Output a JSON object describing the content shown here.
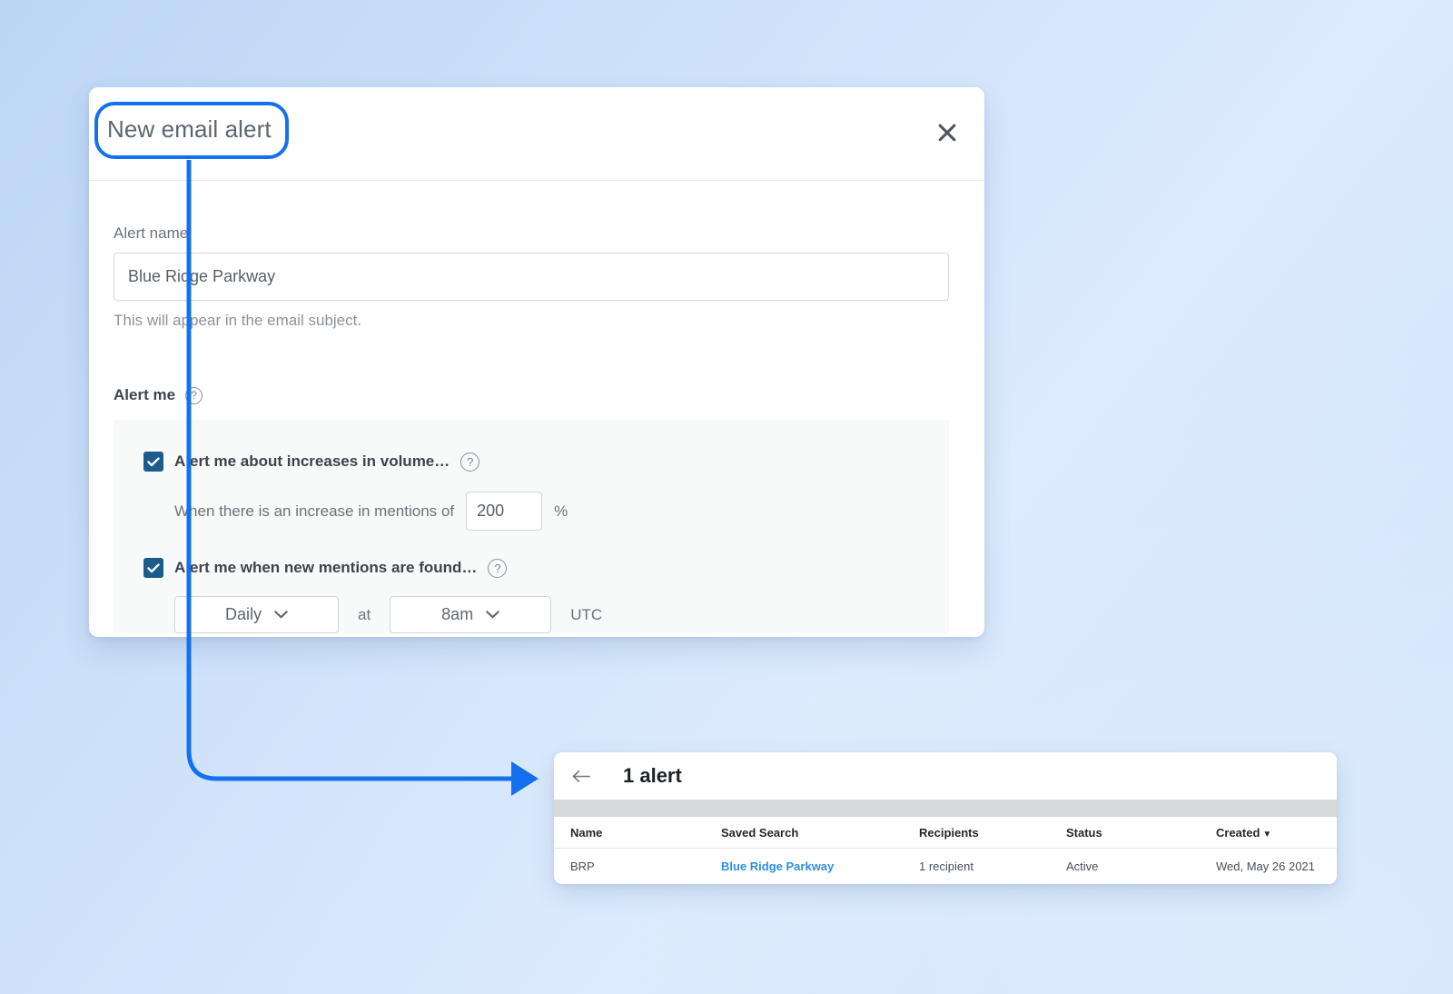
{
  "background": {
    "gradient_from": "#bcd6f5",
    "gradient_to": "#dcebfd"
  },
  "annotation": {
    "color": "#1570ef",
    "callout_target": "New email alert",
    "arrow_from": "dialog-title",
    "arrow_to": "alerts-list-panel"
  },
  "dialog": {
    "title": "New email alert",
    "close_label": "✕",
    "alert_name": {
      "label": "Alert name",
      "value": "Blue Ridge Parkway",
      "placeholder": "Alert name",
      "hint": "This will appear in the email subject."
    },
    "alert_me": {
      "heading": "Alert me",
      "help_glyph": "?",
      "options": [
        {
          "label": "Alert me about increases in volume…",
          "checked": true,
          "help_glyph": "?",
          "sub_prefix": "When there is an increase in mentions of",
          "sub_value": "200",
          "sub_suffix": "%"
        },
        {
          "label": "Alert me when new mentions are found…",
          "checked": true,
          "help_glyph": "?",
          "frequency": "Daily",
          "at_label": "at",
          "time": "8am",
          "timezone": "UTC"
        }
      ]
    }
  },
  "alerts_panel": {
    "back_label": "←",
    "title": "1 alert",
    "columns": [
      {
        "label": "Name",
        "sorted": false
      },
      {
        "label": "Saved Search",
        "sorted": false
      },
      {
        "label": "Recipients",
        "sorted": false
      },
      {
        "label": "Status",
        "sorted": false
      },
      {
        "label": "Created",
        "sorted": true,
        "sort_caret": "▼"
      }
    ],
    "rows": [
      {
        "name": "BRP",
        "saved_search": "Blue Ridge Parkway",
        "recipients": "1 recipient",
        "status": "Active",
        "created": "Wed, May 26 2021"
      }
    ]
  }
}
